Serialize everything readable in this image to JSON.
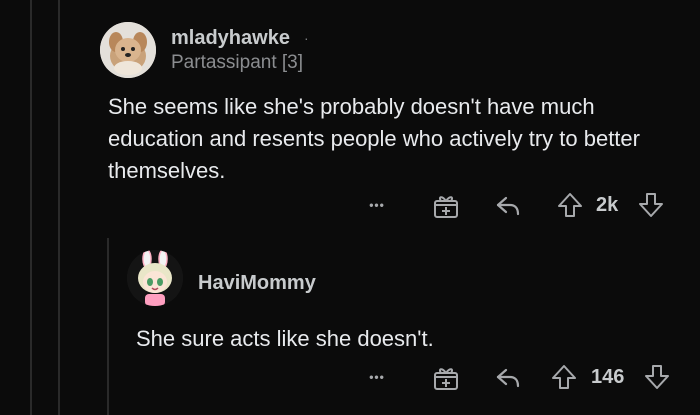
{
  "comment_1": {
    "username": "mladyhawke",
    "separator": "·",
    "flair": "Partassipant [3]",
    "body": "She seems like she's probably doesn't have much education and resents people who actively try to better themselves.",
    "more_label": "•••",
    "score": "2k"
  },
  "comment_2": {
    "username": "HaviMommy",
    "body": "She sure acts like she doesn't.",
    "more_label": "•••",
    "score": "146"
  }
}
